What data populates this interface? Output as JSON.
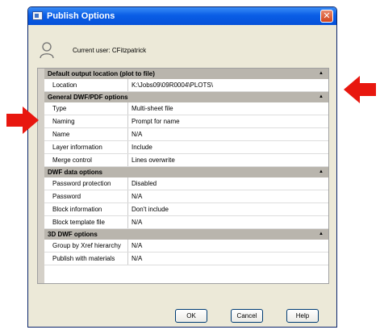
{
  "window": {
    "title": "Publish Options",
    "close_glyph": "✕"
  },
  "user": {
    "label": "Current user: CFitzpatrick",
    "icon": "user-icon"
  },
  "sections": [
    {
      "title": "Default output location (plot to file)",
      "toggle": "▲",
      "rows": [
        {
          "name": "Location",
          "value": "K:\\Jobs09\\09R0004\\PLOTS\\"
        }
      ]
    },
    {
      "title": "General DWF/PDF options",
      "toggle": "▲",
      "rows": [
        {
          "name": "Type",
          "value": "Multi-sheet file"
        },
        {
          "name": "Naming",
          "value": "Prompt for name"
        },
        {
          "name": "Name",
          "value": "N/A"
        },
        {
          "name": "Layer information",
          "value": "Include"
        },
        {
          "name": "Merge control",
          "value": "Lines overwrite"
        }
      ]
    },
    {
      "title": "DWF data options",
      "toggle": "▲",
      "rows": [
        {
          "name": "Password protection",
          "value": "Disabled"
        },
        {
          "name": "Password",
          "value": "N/A"
        },
        {
          "name": "Block information",
          "value": "Don't include"
        },
        {
          "name": "Block template file",
          "value": "N/A"
        }
      ]
    },
    {
      "title": "3D DWF options",
      "toggle": "▲",
      "rows": [
        {
          "name": "Group by Xref hierarchy",
          "value": "N/A"
        },
        {
          "name": "Publish with materials",
          "value": "N/A"
        }
      ]
    }
  ],
  "buttons": {
    "ok": "OK",
    "cancel": "Cancel",
    "help": "Help"
  },
  "colors": {
    "annotation_arrow": "#e8170f",
    "title_bar": "#0a5ee6"
  }
}
